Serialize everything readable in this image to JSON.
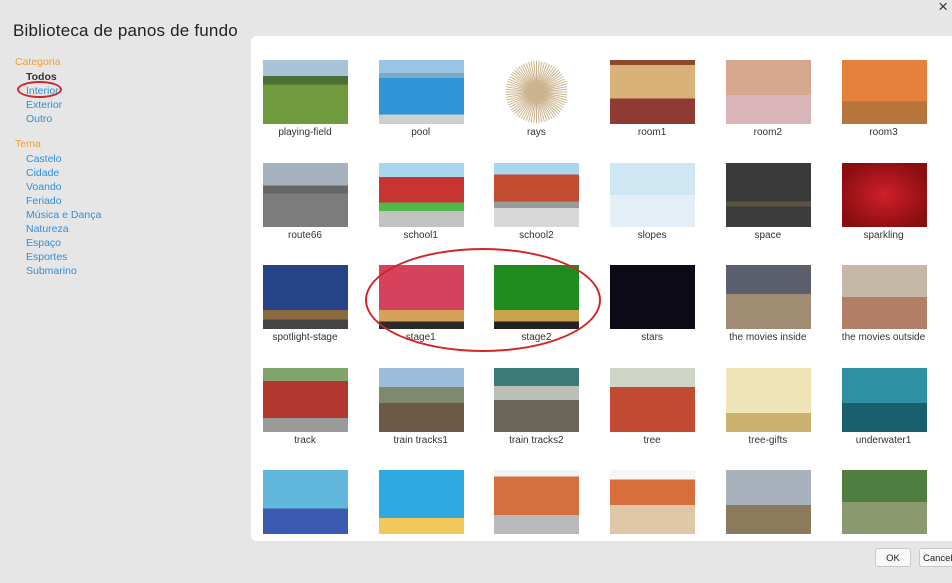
{
  "dialog": {
    "title": "Biblioteca de panos de fundo",
    "close_symbol": "×"
  },
  "sidebar": {
    "category_heading": "Categoria",
    "categories": [
      "Todos",
      "Interior",
      "Exterior",
      "Outro"
    ],
    "selected_category": "Todos",
    "circled_category": "Interior",
    "theme_heading": "Tema",
    "themes": [
      "Castelo",
      "Cidade",
      "Voando",
      "Feriado",
      "Música e Dança",
      "Natureza",
      "Espaço",
      "Esportes",
      "Submarino"
    ]
  },
  "library": {
    "items": [
      {
        "label": "playing-field",
        "thumb": "playing-field"
      },
      {
        "label": "pool",
        "thumb": "pool"
      },
      {
        "label": "rays",
        "thumb": "rays"
      },
      {
        "label": "room1",
        "thumb": "room1"
      },
      {
        "label": "room2",
        "thumb": "room2"
      },
      {
        "label": "room3",
        "thumb": "room3"
      },
      {
        "label": "route66",
        "thumb": "route66"
      },
      {
        "label": "school1",
        "thumb": "school1"
      },
      {
        "label": "school2",
        "thumb": "school2"
      },
      {
        "label": "slopes",
        "thumb": "slopes"
      },
      {
        "label": "space",
        "thumb": "space"
      },
      {
        "label": "sparkling",
        "thumb": "sparkling"
      },
      {
        "label": "spotlight-stage",
        "thumb": "spotlight"
      },
      {
        "label": "stage1",
        "thumb": "stage1"
      },
      {
        "label": "stage2",
        "thumb": "stage2"
      },
      {
        "label": "stars",
        "thumb": "stars"
      },
      {
        "label": "the movies inside",
        "thumb": "movies-in"
      },
      {
        "label": "the movies outside",
        "thumb": "movies-out"
      },
      {
        "label": "track",
        "thumb": "track"
      },
      {
        "label": "train tracks1",
        "thumb": "train1"
      },
      {
        "label": "train tracks2",
        "thumb": "train2"
      },
      {
        "label": "tree",
        "thumb": "tree"
      },
      {
        "label": "tree-gifts",
        "thumb": "tree-gifts"
      },
      {
        "label": "underwater1",
        "thumb": "underwater1"
      },
      {
        "label": "",
        "thumb": "uw2"
      },
      {
        "label": "",
        "thumb": "uw3"
      },
      {
        "label": "",
        "thumb": "urban"
      },
      {
        "label": "",
        "thumb": "urban2"
      },
      {
        "label": "",
        "thumb": "village"
      },
      {
        "label": "",
        "thumb": "woods"
      }
    ],
    "circled_items": [
      "stage1",
      "stage2"
    ]
  },
  "footer": {
    "ok_label": "OK",
    "cancel_label": "Cancel"
  },
  "colors": {
    "accent_orange": "#f2a02b",
    "link_blue": "#2f8fd6",
    "annotation_red": "#d2252a",
    "panel_bg": "#ffffff",
    "dialog_bg": "#e6e6e6"
  }
}
